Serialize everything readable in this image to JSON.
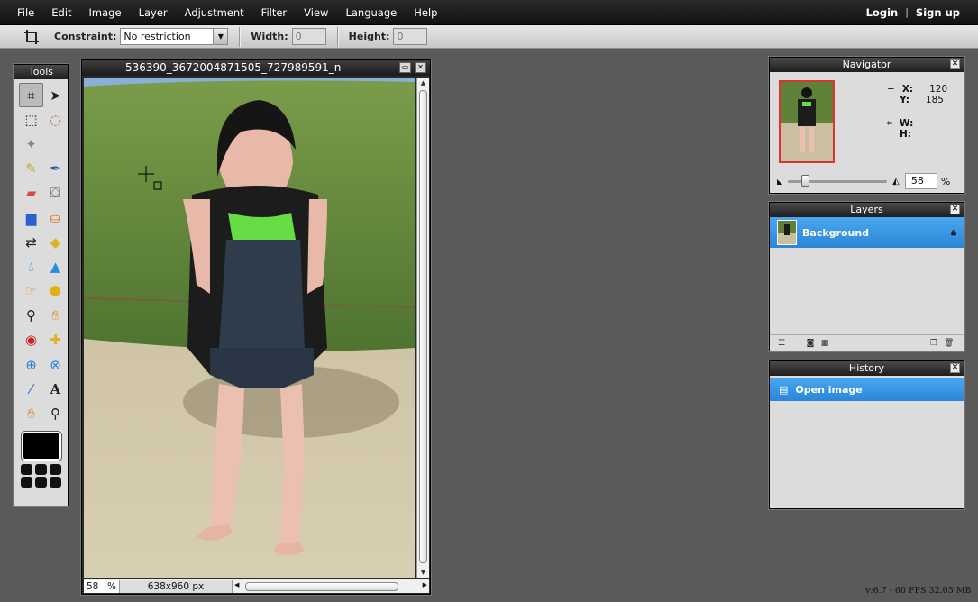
{
  "menubar": {
    "items": [
      "File",
      "Edit",
      "Image",
      "Layer",
      "Adjustment",
      "Filter",
      "View",
      "Language",
      "Help"
    ],
    "login": "Login",
    "separator": "|",
    "signup": "Sign up"
  },
  "toolbar": {
    "constraint_label": "Constraint:",
    "constraint_value": "No restriction",
    "width_label": "Width:",
    "width_value": "0",
    "height_label": "Height:",
    "height_value": "0"
  },
  "tools": {
    "title": "Tools",
    "items": [
      "crop-icon",
      "move-icon",
      "marquee-select-icon",
      "lasso-icon",
      "magic-wand-icon",
      "",
      "pencil-icon",
      "brush-icon",
      "eraser-icon",
      "paint-bucket-icon",
      "gradient-icon",
      "clone-stamp-icon",
      "color-replace-icon",
      "shape-icon",
      "blur-icon",
      "sharpen-icon",
      "smudge-icon",
      "sponge-icon",
      "dodge-icon",
      "burn-icon",
      "red-eye-icon",
      "spot-heal-icon",
      "bloat-icon",
      "pinch-icon",
      "color-picker-icon",
      "type-icon",
      "hand-icon",
      "zoom-icon"
    ]
  },
  "document": {
    "title": "536390_3672004871505_727989591_n",
    "zoom": "58",
    "zoom_unit": "%",
    "dimensions": "638x960 px"
  },
  "navigator": {
    "title": "Navigator",
    "x_label": "X:",
    "x_value": "120",
    "y_label": "Y:",
    "y_value": "185",
    "w_label": "W:",
    "h_label": "H:",
    "zoom_value": "58",
    "zoom_unit": "%"
  },
  "layers": {
    "title": "Layers",
    "items": [
      {
        "name": "Background",
        "locked": true
      }
    ]
  },
  "history": {
    "title": "History",
    "items": [
      "Open image"
    ]
  },
  "status": {
    "fps_text": "v:6.7 - 60 FPS 32.05 MB"
  },
  "colors": {
    "menubar": "#1a1a1a",
    "selection": "#2b86d8",
    "workspace": "#5a5a5a"
  }
}
